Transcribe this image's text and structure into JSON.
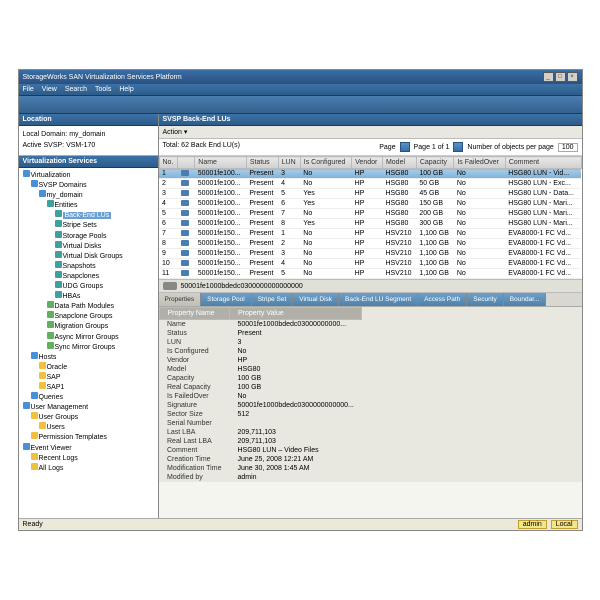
{
  "title": "StorageWorks SAN Virtualization Services Platform",
  "menu": [
    "File",
    "View",
    "Search",
    "Tools",
    "Help"
  ],
  "location_hdr": "Location",
  "location": {
    "l1": "Local Domain:   my_domain",
    "l2": "Active SVSP:    VSM-170"
  },
  "vs_hdr": "Virtualization Services",
  "tree": [
    {
      "lvl": 0,
      "icon": "i-blue",
      "txt": "Virtualization"
    },
    {
      "lvl": 1,
      "icon": "i-blue",
      "txt": "SVSP Domains"
    },
    {
      "lvl": 2,
      "icon": "i-blue",
      "txt": "my_domain"
    },
    {
      "lvl": 3,
      "icon": "i-teal",
      "txt": "Entities"
    },
    {
      "lvl": 4,
      "icon": "i-teal",
      "txt": "Back-End LUs",
      "sel": true
    },
    {
      "lvl": 4,
      "icon": "i-teal",
      "txt": "Stripe Sets"
    },
    {
      "lvl": 4,
      "icon": "i-teal",
      "txt": "Storage Pools"
    },
    {
      "lvl": 4,
      "icon": "i-teal",
      "txt": "Virtual Disks"
    },
    {
      "lvl": 4,
      "icon": "i-teal",
      "txt": "Virtual Disk Groups"
    },
    {
      "lvl": 4,
      "icon": "i-teal",
      "txt": "Snapshots"
    },
    {
      "lvl": 4,
      "icon": "i-teal",
      "txt": "Snapclones"
    },
    {
      "lvl": 4,
      "icon": "i-teal",
      "txt": "UDG Groups"
    },
    {
      "lvl": 4,
      "icon": "i-teal",
      "txt": "HBAs"
    },
    {
      "lvl": 3,
      "icon": "i-green",
      "txt": "Data Path Modules"
    },
    {
      "lvl": 3,
      "icon": "i-green",
      "txt": "Snapclone Groups"
    },
    {
      "lvl": 3,
      "icon": "i-green",
      "txt": "Migration Groups"
    },
    {
      "lvl": 3,
      "icon": "i-green",
      "txt": "Async Mirror Groups"
    },
    {
      "lvl": 3,
      "icon": "i-green",
      "txt": "Sync Mirror Groups"
    },
    {
      "lvl": 1,
      "icon": "i-blue",
      "txt": "Hosts"
    },
    {
      "lvl": 2,
      "icon": "i-yellow",
      "txt": "Oracle"
    },
    {
      "lvl": 2,
      "icon": "i-yellow",
      "txt": "SAP"
    },
    {
      "lvl": 2,
      "icon": "i-yellow",
      "txt": "SAP1"
    },
    {
      "lvl": 1,
      "icon": "i-blue",
      "txt": "Queries"
    },
    {
      "lvl": 0,
      "icon": "i-blue",
      "txt": "User Management"
    },
    {
      "lvl": 1,
      "icon": "i-yellow",
      "txt": "User Groups"
    },
    {
      "lvl": 2,
      "icon": "i-yellow",
      "txt": "Users"
    },
    {
      "lvl": 1,
      "icon": "i-yellow",
      "txt": "Permission Templates"
    },
    {
      "lvl": 0,
      "icon": "i-blue",
      "txt": "Event Viewer"
    },
    {
      "lvl": 1,
      "icon": "i-yellow",
      "txt": "Recent Logs"
    },
    {
      "lvl": 1,
      "icon": "i-yellow",
      "txt": "All Logs"
    }
  ],
  "main_hdr": "SVSP Back-End LUs",
  "action": "Action ▾",
  "total": "Total: 62 Back End LU(s)",
  "page_lbl": "Page",
  "page_txt": "Page 1 of 1",
  "objs_lbl": "Number of objects per page",
  "objs_val": "100",
  "cols": [
    "No.",
    "",
    "Name",
    "Status",
    "LUN",
    "Is Configured",
    "Vendor",
    "Model",
    "Capacity",
    "Is FailedOver",
    "Comment"
  ],
  "rows": [
    {
      "n": "1",
      "name": "50001fe100...",
      "st": "Present",
      "lun": "3",
      "cfg": "No",
      "v": "HP",
      "m": "HSG80",
      "cap": "100   GB",
      "fo": "No",
      "c": "HSG80 LUN - Vid...",
      "sel": true
    },
    {
      "n": "2",
      "name": "50001fe100...",
      "st": "Present",
      "lun": "4",
      "cfg": "No",
      "v": "HP",
      "m": "HSG80",
      "cap": "50   GB",
      "fo": "No",
      "c": "HSG80 LUN - Exc..."
    },
    {
      "n": "3",
      "name": "50001fe100...",
      "st": "Present",
      "lun": "5",
      "cfg": "Yes",
      "v": "HP",
      "m": "HSG80",
      "cap": "45   GB",
      "fo": "No",
      "c": "HSG80 LUN - Data..."
    },
    {
      "n": "4",
      "name": "50001fe100...",
      "st": "Present",
      "lun": "6",
      "cfg": "Yes",
      "v": "HP",
      "m": "HSG80",
      "cap": "150   GB",
      "fo": "No",
      "c": "HSG80 LUN - Mari..."
    },
    {
      "n": "5",
      "name": "50001fe100...",
      "st": "Present",
      "lun": "7",
      "cfg": "No",
      "v": "HP",
      "m": "HSG80",
      "cap": "200   GB",
      "fo": "No",
      "c": "HSG80 LUN - Mari..."
    },
    {
      "n": "6",
      "name": "50001fe100...",
      "st": "Present",
      "lun": "8",
      "cfg": "Yes",
      "v": "HP",
      "m": "HSG80",
      "cap": "300   GB",
      "fo": "No",
      "c": "HSG80 LUN - Mari..."
    },
    {
      "n": "7",
      "name": "50001fe150...",
      "st": "Present",
      "lun": "1",
      "cfg": "No",
      "v": "HP",
      "m": "HSV210",
      "cap": "1,100   GB",
      "fo": "No",
      "c": "EVA8000-1 FC Vd..."
    },
    {
      "n": "8",
      "name": "50001fe150...",
      "st": "Present",
      "lun": "2",
      "cfg": "No",
      "v": "HP",
      "m": "HSV210",
      "cap": "1,100   GB",
      "fo": "No",
      "c": "EVA8000-1 FC Vd..."
    },
    {
      "n": "9",
      "name": "50001fe150...",
      "st": "Present",
      "lun": "3",
      "cfg": "No",
      "v": "HP",
      "m": "HSV210",
      "cap": "1,100   GB",
      "fo": "No",
      "c": "EVA8000-1 FC Vd..."
    },
    {
      "n": "10",
      "name": "50001fe150...",
      "st": "Present",
      "lun": "4",
      "cfg": "No",
      "v": "HP",
      "m": "HSV210",
      "cap": "1,100   GB",
      "fo": "No",
      "c": "EVA8000-1 FC Vd..."
    },
    {
      "n": "11",
      "name": "50001fe150...",
      "st": "Present",
      "lun": "5",
      "cfg": "No",
      "v": "HP",
      "m": "HSV210",
      "cap": "1,100   GB",
      "fo": "No",
      "c": "EVA8000-1 FC Vd..."
    }
  ],
  "detail_name": "50001fe1000bdedc0300000000000000",
  "tabs": [
    "Properties",
    "Storage Pool",
    "Stripe Set",
    "Virtual Disk",
    "Back-End LU Segment",
    "Access Path",
    "Security",
    "Boundar..."
  ],
  "props_hdr": [
    "Property Name",
    "Property Value"
  ],
  "props": [
    [
      "Name",
      "50001fe1000bdedc03000000000..."
    ],
    [
      "Status",
      "Present"
    ],
    [
      "LUN",
      "3"
    ],
    [
      "Is Configured",
      "No"
    ],
    [
      "Vendor",
      "HP"
    ],
    [
      "Model",
      "HSG80"
    ],
    [
      "Capacity",
      "100   GB"
    ],
    [
      "Real Capacity",
      "100   GB"
    ],
    [
      "Is FailedOver",
      "No"
    ],
    [
      "Signature",
      "50001fe1000bdedc0300000000000..."
    ],
    [
      "Sector Size",
      "512"
    ],
    [
      "Serial Number",
      ""
    ],
    [
      "Last LBA",
      "209,711,103"
    ],
    [
      "Real Last LBA",
      "209,711,103"
    ],
    [
      "Comment",
      "HSG80 LUN – Video Files"
    ],
    [
      "Creation Time",
      "June 25, 2008 12:21 AM"
    ],
    [
      "Modification Time",
      "June 30, 2008 1:45 AM"
    ],
    [
      "Modified by",
      "admin"
    ]
  ],
  "status_left": "Ready",
  "status_user": "admin",
  "status_local": "Local"
}
